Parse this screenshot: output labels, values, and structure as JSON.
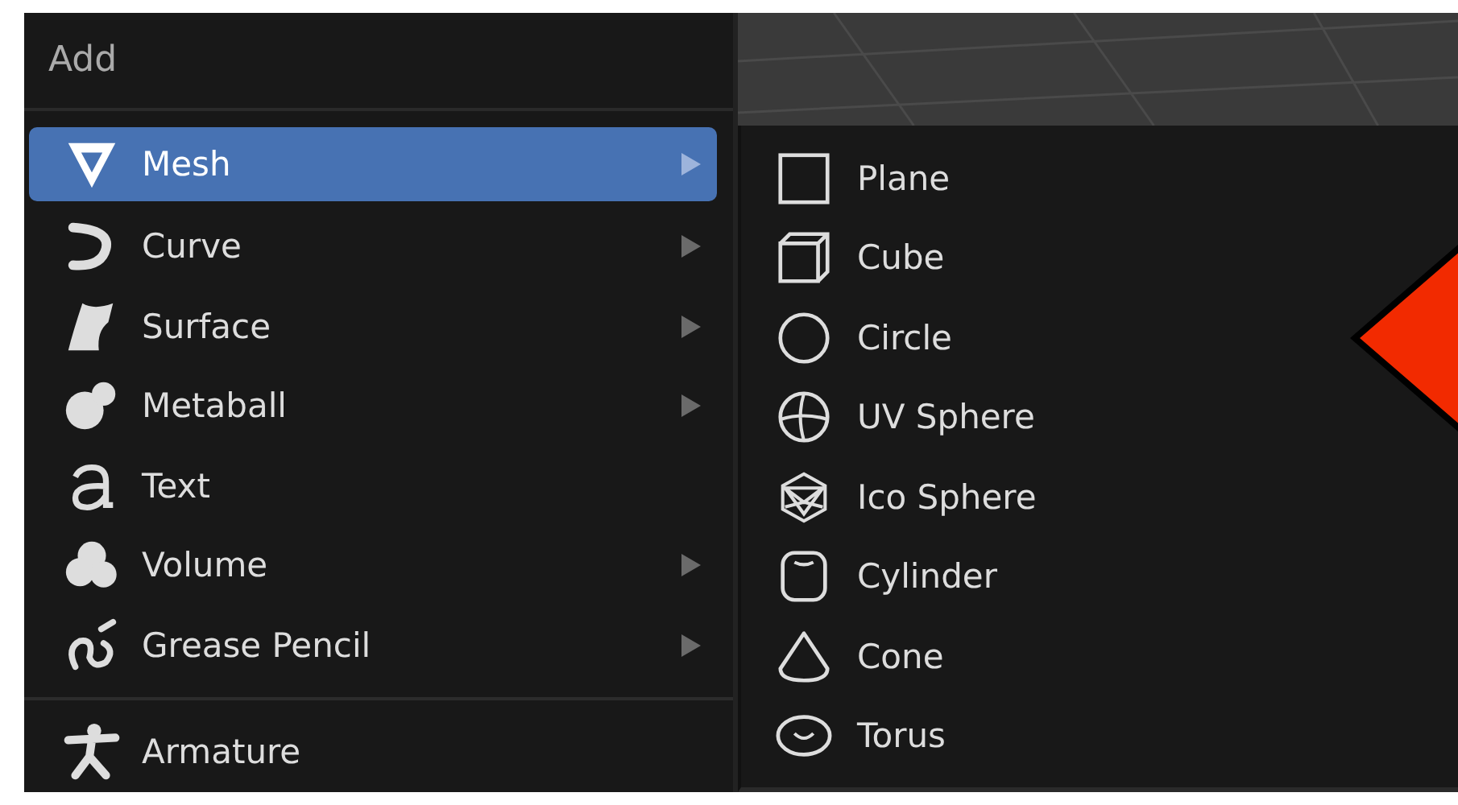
{
  "menu": {
    "title": "Add",
    "items": [
      {
        "label": "Mesh",
        "kind": "mesh",
        "selected": true,
        "submenu": true
      },
      {
        "label": "Curve",
        "kind": "curve",
        "selected": false,
        "submenu": true
      },
      {
        "label": "Surface",
        "kind": "surface",
        "selected": false,
        "submenu": true
      },
      {
        "label": "Metaball",
        "kind": "metaball",
        "selected": false,
        "submenu": true
      },
      {
        "label": "Text",
        "kind": "text",
        "selected": false,
        "submenu": false
      },
      {
        "label": "Volume",
        "kind": "volume",
        "selected": false,
        "submenu": true
      },
      {
        "label": "Grease Pencil",
        "kind": "pencil",
        "selected": false,
        "submenu": true
      }
    ],
    "section_items": [
      {
        "label": "Armature",
        "kind": "armature",
        "selected": false,
        "submenu": false
      }
    ]
  },
  "submenu": {
    "items": [
      {
        "label": "Plane",
        "kind": "plane"
      },
      {
        "label": "Cube",
        "kind": "cube"
      },
      {
        "label": "Circle",
        "kind": "circle"
      },
      {
        "label": "UV Sphere",
        "kind": "uvsphere"
      },
      {
        "label": "Ico Sphere",
        "kind": "icosphere"
      },
      {
        "label": "Cylinder",
        "kind": "cylinder"
      },
      {
        "label": "Cone",
        "kind": "cone"
      },
      {
        "label": "Torus",
        "kind": "torus"
      }
    ]
  }
}
